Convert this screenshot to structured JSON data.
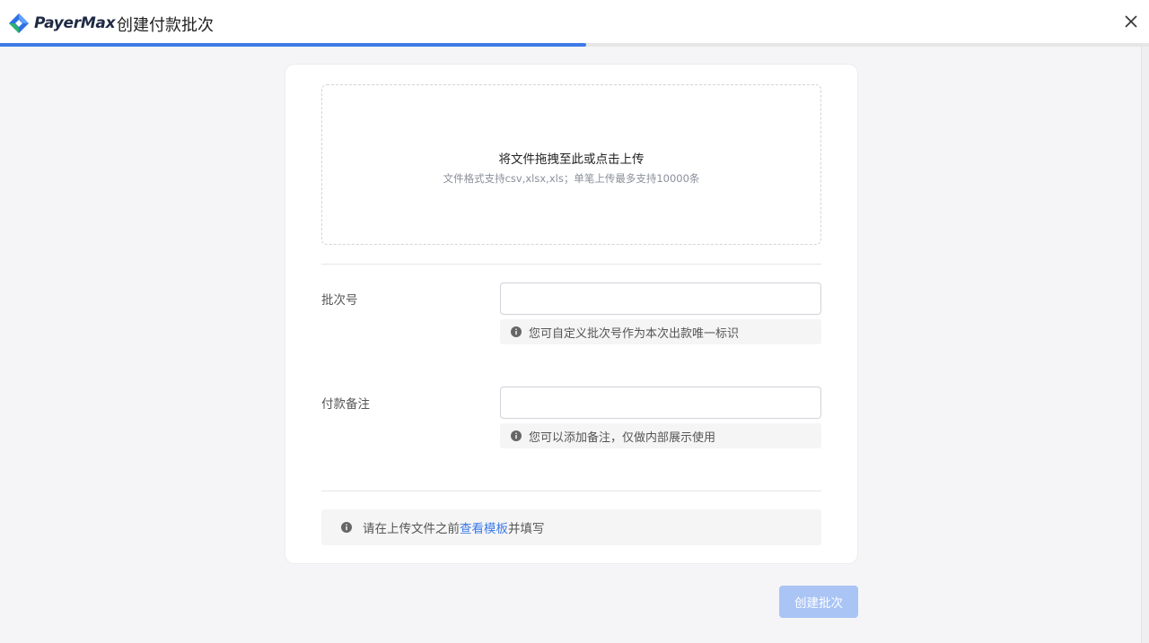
{
  "header": {
    "brand": "PayerMax",
    "title": "创建付款批次",
    "progress_percent": 51
  },
  "upload": {
    "title": "将文件拖拽至此或点击上传",
    "subtitle": "文件格式支持csv,xlsx,xls；单笔上传最多支持10000条"
  },
  "fields": {
    "batch_no": {
      "label": "批次号",
      "value": "",
      "hint": "您可自定义批次号作为本次出款唯一标识"
    },
    "remark": {
      "label": "付款备注",
      "value": "",
      "hint": "您可以添加备注，仅做内部展示使用"
    }
  },
  "notice": {
    "before": "请在上传文件之前",
    "link": "查看模板",
    "after": "并填写"
  },
  "actions": {
    "submit_label": "创建批次"
  },
  "colors": {
    "accent": "#3d7be8",
    "submit_disabled": "#a9c4f5"
  },
  "icons": {
    "close": "close-icon",
    "info": "info-icon",
    "logo": "payermax-logo"
  }
}
